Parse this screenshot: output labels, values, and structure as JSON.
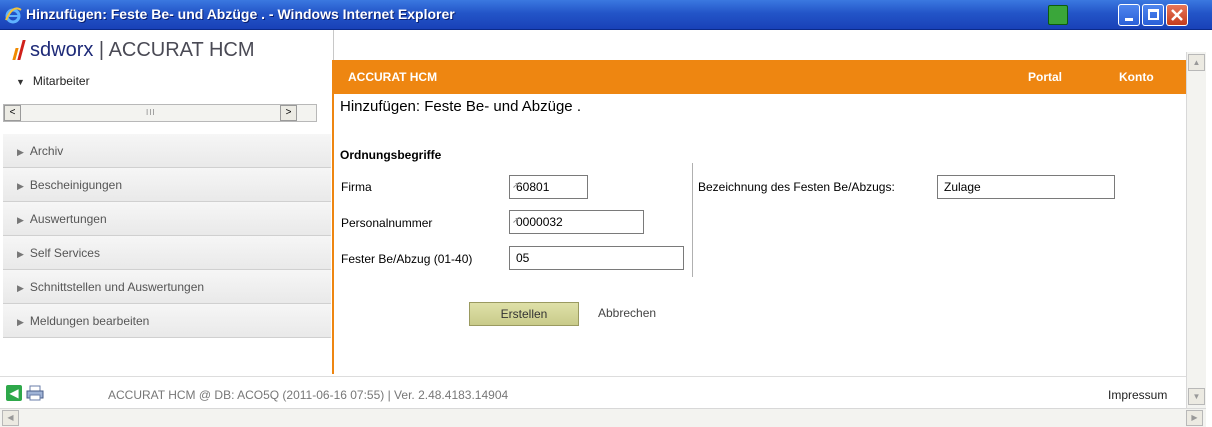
{
  "window": {
    "title": "Hinzufügen: Feste Be- und Abzüge . - Windows Internet Explorer",
    "minimize": "_",
    "maximize": "□",
    "close": "X"
  },
  "sidebar": {
    "logo_brand": "sdworx",
    "logo_product": " | ACCURAT HCM",
    "mitarbeiter": "Mitarbeiter",
    "scroll_left": "<",
    "scroll_right": ">",
    "scroll_grip": "III",
    "items": [
      {
        "label": "Archiv"
      },
      {
        "label": "Bescheinigungen"
      },
      {
        "label": "Auswertungen"
      },
      {
        "label": "Self Services"
      },
      {
        "label": "Schnittstellen und Auswertungen"
      },
      {
        "label": "Meldungen bearbeiten"
      }
    ]
  },
  "header": {
    "brand": "ACCURAT HCM",
    "portal": "Portal",
    "konto": "Konto"
  },
  "main": {
    "title": "Hinzufügen: Feste Be- und Abzüge .",
    "section": "Ordnungsbegriffe",
    "firma_label": "Firma",
    "firma_value": "60801",
    "personal_label": "Personalnummer",
    "personal_value": "0000032",
    "fester_label": "Fester Be/Abzug (01-40)",
    "fester_value": "05",
    "bezeichnung_label": "Bezeichnung des Festen Be/Abzugs:",
    "bezeichnung_value": "Zulage",
    "create_button": "Erstellen",
    "cancel_link": "Abbrechen"
  },
  "footer": {
    "info": "ACCURAT HCM @ DB: ACO5Q (2011-06-16 07:55) | Ver. 2.48.4183.14904",
    "impressum": "Impressum"
  },
  "colors": {
    "accent": "#ee8611",
    "titlebar": "#2355c8"
  }
}
